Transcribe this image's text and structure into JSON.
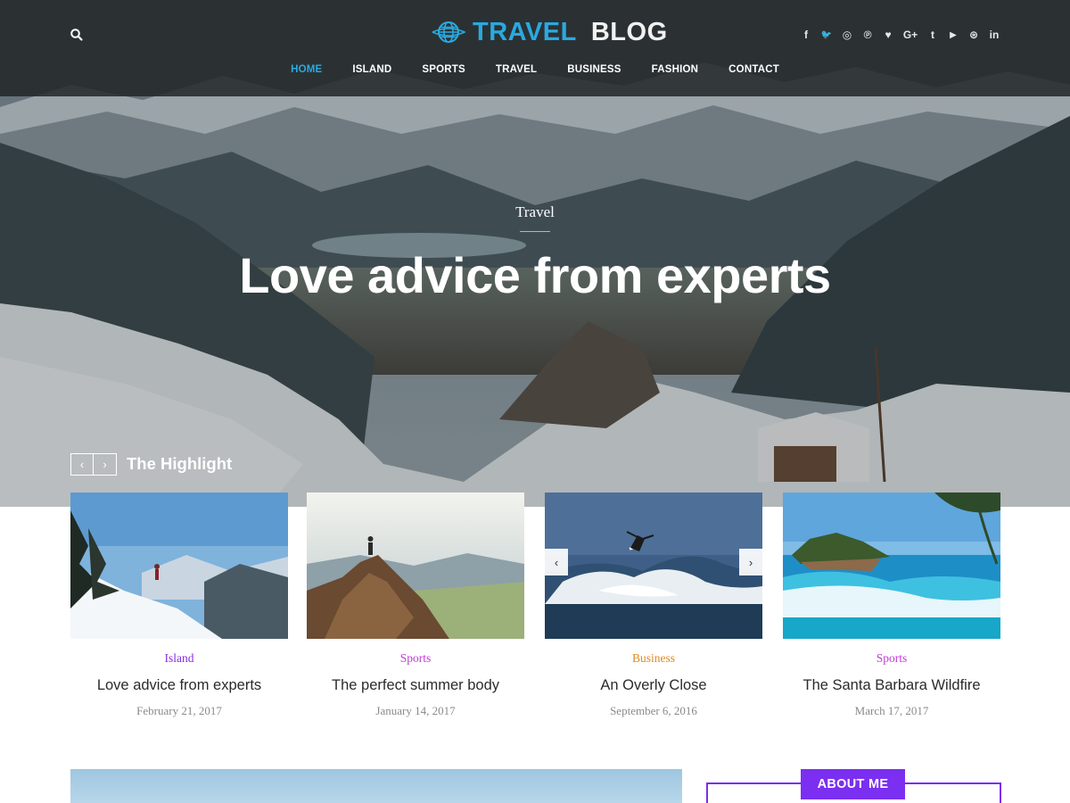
{
  "header": {
    "logo": {
      "word1": "TRAVEL",
      "word2": "BLOG",
      "icon": "globe-icon"
    },
    "search_icon": "search-icon",
    "social": [
      {
        "name": "facebook",
        "glyph": "f"
      },
      {
        "name": "twitter",
        "glyph": "🐦"
      },
      {
        "name": "instagram",
        "glyph": "◎"
      },
      {
        "name": "pinterest",
        "glyph": "℗"
      },
      {
        "name": "heart",
        "glyph": "♥"
      },
      {
        "name": "google-plus",
        "glyph": "G+"
      },
      {
        "name": "tumblr",
        "glyph": "t"
      },
      {
        "name": "youtube",
        "glyph": "▶"
      },
      {
        "name": "dribbble",
        "glyph": "⊛"
      },
      {
        "name": "linkedin",
        "glyph": "in"
      }
    ],
    "nav": [
      "HOME",
      "ISLAND",
      "SPORTS",
      "TRAVEL",
      "BUSINESS",
      "FASHION",
      "CONTACT"
    ],
    "active_nav": "HOME"
  },
  "hero": {
    "category": "Travel",
    "title": "Love advice from experts"
  },
  "highlight": {
    "title": "The Highlight",
    "prev_glyph": "‹",
    "next_glyph": "›",
    "cards": [
      {
        "category": "Island",
        "category_color": "#8a2be2",
        "title": "Love advice from experts",
        "date": "February 21, 2017"
      },
      {
        "category": "Sports",
        "category_color": "#c23ad8",
        "title": "The perfect summer body",
        "date": "January 14, 2017"
      },
      {
        "category": "Business",
        "category_color": "#e08a1e",
        "title": "An Overly Close",
        "date": "September 6, 2016"
      },
      {
        "category": "Sports",
        "category_color": "#c23ad8",
        "title": "The Santa Barbara Wildfire",
        "date": "March 17, 2017"
      }
    ]
  },
  "sidebar": {
    "about_label": "ABOUT ME"
  },
  "colors": {
    "accent": "#2aa9e0",
    "about": "#7b2ff0"
  }
}
